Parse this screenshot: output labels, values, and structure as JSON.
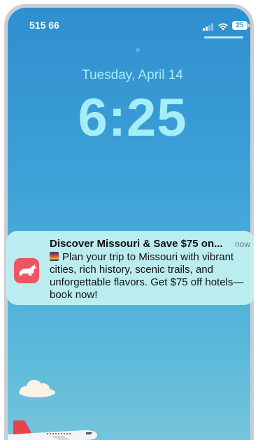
{
  "status_bar": {
    "carrier": "515 66",
    "battery_level": "25",
    "signal_bars_active": 2,
    "signal_bars_total": 4,
    "icons": [
      "signal-icon",
      "wifi-icon",
      "battery-icon"
    ]
  },
  "lock_screen": {
    "date": "Tuesday, April 14",
    "time": "6:25"
  },
  "notification": {
    "app_icon": "rabbit-icon",
    "title": "Discover Missouri & Save $75 on...",
    "timestamp": "now",
    "body_emoji": "sunset-emoji",
    "body": "Plan your trip to Missouri with vibrant cities, rich history, scenic trails, and unforgettable flavors. Get $75 off hotels—book now!"
  },
  "wallpaper": {
    "elements": [
      "cloud-illustration",
      "airplane-illustration"
    ]
  },
  "colors": {
    "wallpaper_top": "#2f8fcf",
    "wallpaper_bottom": "#76c6dc",
    "clock_text": "#a6eef7",
    "notification_bg": "#c4f1f0",
    "app_icon_bg": "#ee5560"
  }
}
